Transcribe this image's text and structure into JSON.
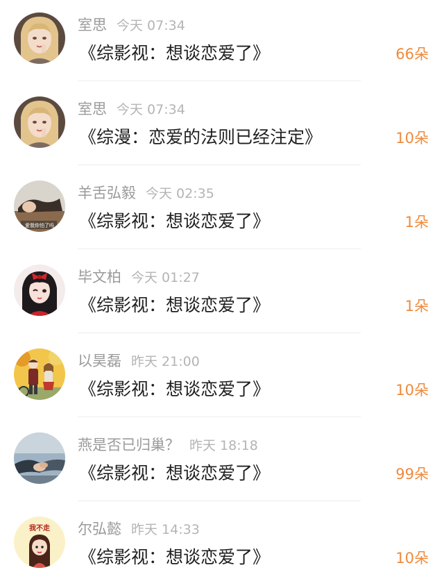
{
  "items": [
    {
      "name": "室思",
      "time": "今天 07:34",
      "title": "《综影视：想谈恋爱了》",
      "count": "66朵",
      "avatar": "anime-girl-blonde-avatar"
    },
    {
      "name": "室思",
      "time": "今天 07:34",
      "title": "《综漫：恋爱的法则已经注定》",
      "count": "10朵",
      "avatar": "anime-girl-blonde-avatar"
    },
    {
      "name": "羊舌弘毅",
      "time": "今天 02:35",
      "title": "《综影视：想谈恋爱了》",
      "count": "1朵",
      "avatar": "photo-desk-avatar",
      "avatar_caption": "爱我你怕了吗"
    },
    {
      "name": "毕文柏",
      "time": "今天 01:27",
      "title": "《综影视：想谈恋爱了》",
      "count": "1朵",
      "avatar": "anime-girl-red-bow-avatar"
    },
    {
      "name": "以昊磊",
      "time": "昨天 21:00",
      "title": "《综影视：想谈恋爱了》",
      "count": "10朵",
      "avatar": "anime-couple-autumn-avatar"
    },
    {
      "name": "燕是否已归巢？",
      "time": "昨天 18:18",
      "title": "《综影视：想谈恋爱了》",
      "count": "99朵",
      "avatar": "holding-hands-avatar"
    },
    {
      "name": "尔弘懿",
      "time": "昨天 14:33",
      "title": "《综影视：想谈恋爱了》",
      "count": "10朵",
      "avatar": "cartoon-girl-sticker-avatar",
      "avatar_caption": "我不走"
    }
  ],
  "colors": {
    "name": "#9a9a9a",
    "time": "#b4b4b4",
    "title": "#1f1f1f",
    "count": "#ee8a3c",
    "divider": "#eeeeee"
  }
}
